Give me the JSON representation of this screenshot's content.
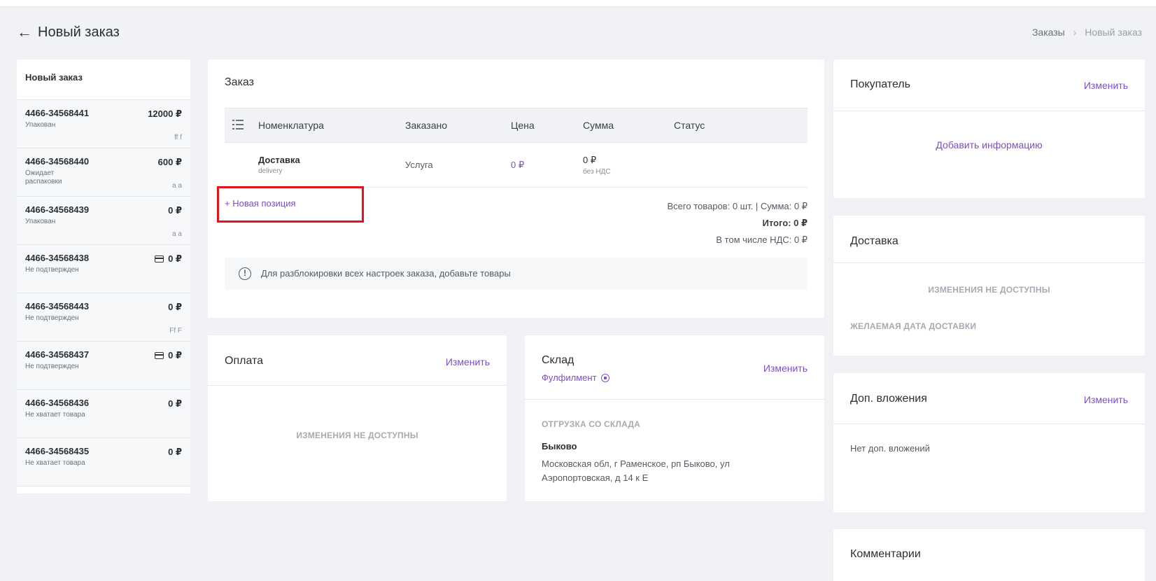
{
  "header": {
    "back_icon": "←",
    "title": "Новый заказ",
    "breadcrumb": {
      "parent": "Заказы",
      "separator": "›",
      "current": "Новый заказ"
    }
  },
  "sidebar": {
    "title": "Новый заказ",
    "orders": [
      {
        "number": "4466-34568441",
        "amount": "12000 ₽",
        "status": "Упакован",
        "tag": "ff f",
        "card_icon": false
      },
      {
        "number": "4466-34568440",
        "amount": "600 ₽",
        "status": "Ожидает распаковки",
        "tag": "a a",
        "card_icon": false
      },
      {
        "number": "4466-34568439",
        "amount": "0 ₽",
        "status": "Упакован",
        "tag": "a a",
        "card_icon": false
      },
      {
        "number": "4466-34568438",
        "amount": "0 ₽",
        "status": "Не подтвержден",
        "tag": "",
        "card_icon": true
      },
      {
        "number": "4466-34568443",
        "amount": "0 ₽",
        "status": "Не подтвержден",
        "tag": "Ff F",
        "card_icon": false
      },
      {
        "number": "4466-34568437",
        "amount": "0 ₽",
        "status": "Не подтвержден",
        "tag": "",
        "card_icon": true
      },
      {
        "number": "4466-34568436",
        "amount": "0 ₽",
        "status": "Не хватает товара",
        "tag": "",
        "card_icon": false
      },
      {
        "number": "4466-34568435",
        "amount": "0 ₽",
        "status": "Не хватает товара",
        "tag": "",
        "card_icon": false
      }
    ]
  },
  "order": {
    "title": "Заказ",
    "columns": [
      "Номенклатура",
      "Заказано",
      "Цена",
      "Сумма",
      "Статус"
    ],
    "row": {
      "name": "Доставка",
      "code": "delivery",
      "ordered": "Услуга",
      "price": "0 ₽",
      "sum": "0 ₽",
      "sum_note": "без НДС",
      "status": ""
    },
    "new_position": "+ Новая позиция",
    "totals": {
      "line1": "Всего товаров: 0 шт. | Сумма: 0 ₽",
      "line2": "Итого: 0 ₽",
      "line3": "В том числе НДС: 0 ₽"
    },
    "notice": "Для разблокировки всех настроек заказа, добавьте товары",
    "notice_icon": "!"
  },
  "payment": {
    "title": "Оплата",
    "change": "Изменить",
    "unavailable": "ИЗМЕНЕНИЯ НЕ ДОСТУПНЫ"
  },
  "warehouse": {
    "title": "Склад",
    "type": "Фулфилмент",
    "change": "Изменить",
    "section": "ОТГРУЗКА СО СКЛАДА",
    "name": "Быково",
    "address": "Московская обл, г Раменское, рп Быково, ул Аэропортовская, д 14 к Е"
  },
  "buyer": {
    "title": "Покупатель",
    "change": "Изменить",
    "add_info": "Добавить информацию"
  },
  "delivery": {
    "title": "Доставка",
    "unavailable": "ИЗМЕНЕНИЯ НЕ ДОСТУПНЫ",
    "desired_date": "ЖЕЛАЕМАЯ ДАТА ДОСТАВКИ"
  },
  "attachments": {
    "title": "Доп. вложения",
    "change": "Изменить",
    "empty": "Нет доп. вложений"
  },
  "comments": {
    "title": "Комментарии"
  },
  "colors": {
    "accent": "#7b4fc4",
    "highlight": "#e8141c",
    "background": "#f0f2f5"
  }
}
